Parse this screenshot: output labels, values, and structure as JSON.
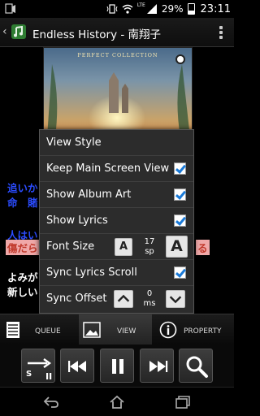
{
  "status_bar": {
    "network": "LTE",
    "battery_percent": "29%",
    "time": "23:11"
  },
  "action_bar": {
    "title": "Endless History - 南翔子"
  },
  "album": {
    "title_text": "PERFECT COLLECTION"
  },
  "lyrics": [
    {
      "text": "追いか",
      "style": "blue"
    },
    {
      "text": "命　賭",
      "style": "blue"
    },
    {
      "text": "人はい",
      "style": "blue"
    },
    {
      "text": "傷だら",
      "style": "highlight"
    },
    {
      "text": "る",
      "style": "highlight"
    },
    {
      "text": "よみが",
      "style": "white"
    },
    {
      "text": "新しい",
      "style": "white"
    }
  ],
  "menu": {
    "header": "View Style",
    "items": [
      {
        "label": "Keep Main Screen View",
        "checked": true
      },
      {
        "label": "Show Album Art",
        "checked": true
      },
      {
        "label": "Show Lyrics",
        "checked": true
      }
    ],
    "font_size": {
      "label": "Font Size",
      "small_btn": "A",
      "large_btn": "A",
      "value": "17",
      "unit": "sp"
    },
    "sync_lyrics": {
      "label": "Sync Lyrics Scroll",
      "checked": true
    },
    "sync_offset": {
      "label": "Sync Offset",
      "value": "0",
      "unit": "ms"
    }
  },
  "tabs": {
    "queue": "QUEUE",
    "view": "VIEW",
    "property": "PROPERTY"
  },
  "controls": {
    "repeat_s": "S"
  },
  "colors": {
    "lyric_blue": "#2b4cff",
    "lyric_highlight_bg": "#f0a8a8",
    "lyric_highlight_fg": "#c0392b",
    "check_blue": "#1a7ad8",
    "popup_bg": "#2c2c2c"
  },
  "icons": {
    "status_left": "app-notification-icon",
    "wifi": "wifi-icon",
    "signal": "signal-icon",
    "back": "back-arrow-icon",
    "home": "home-icon",
    "recents": "recents-icon"
  }
}
